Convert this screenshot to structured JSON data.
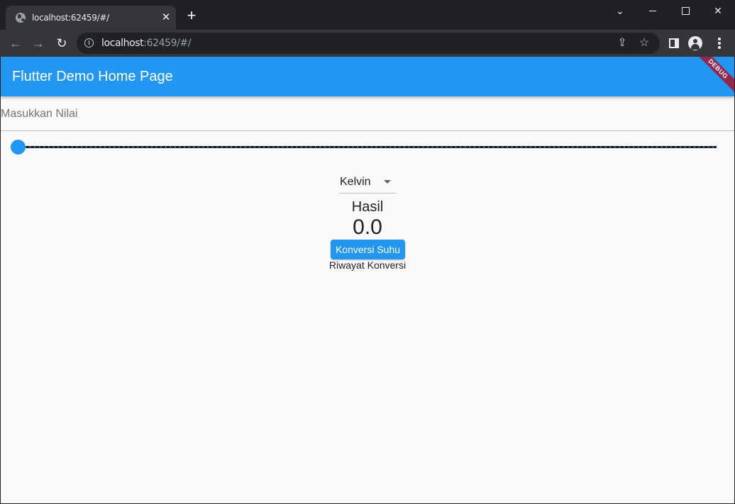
{
  "browser": {
    "tab": {
      "title": "localhost:62459/#/",
      "favicon": "globe-icon"
    },
    "url": {
      "host": "localhost",
      "rest": ":62459/#/"
    }
  },
  "app": {
    "title": "Flutter Demo Home Page",
    "debug_banner": "DEBUG",
    "input": {
      "label": "Masukkan Nilai"
    },
    "slider": {
      "value": 0
    },
    "dropdown": {
      "selected": "Kelvin"
    },
    "result": {
      "label": "Hasil",
      "value": "0.0"
    },
    "convert_button": "Konversi Suhu",
    "history_label": "Riwayat Konversi"
  },
  "colors": {
    "primary": "#2196f3",
    "debug": "#a01c3a",
    "chrome_dark": "#202124",
    "chrome_toolbar": "#35363a"
  }
}
